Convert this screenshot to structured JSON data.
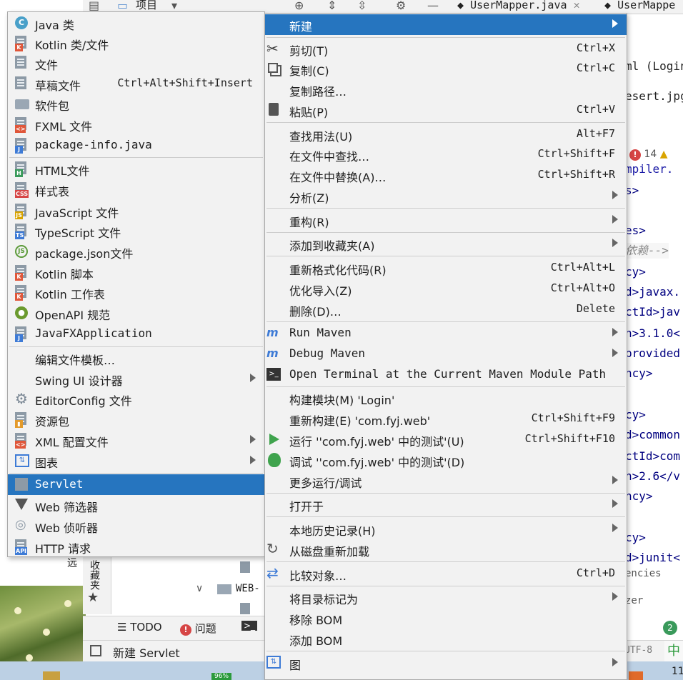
{
  "toolbar": {
    "project_label": "项目",
    "tabs": [
      {
        "label": "UserMapper.java"
      },
      {
        "label": "UserMappe"
      }
    ]
  },
  "editor": {
    "tab_fragments": [
      "ss",
      "ml (Login",
      "esert.jpg"
    ],
    "error_count": "14",
    "lines": [
      "mpiler.",
      "s>",
      "es>",
      "依赖-->",
      "cy>",
      "d>javax.",
      "ctId>jav",
      "n>3.1.0<",
      "provided",
      "ncy>",
      "cy>",
      "d>common",
      "ctId>com",
      "n>2.6</v",
      "ncy>",
      "cy>",
      "d>junit<",
      "encies",
      "zer"
    ]
  },
  "left_panel": {
    "favorites_label": "收藏夹",
    "tree_items": [
      "WEB-",
      "远"
    ]
  },
  "bottom_toolbar": {
    "todo": "TODO",
    "problems": "问题"
  },
  "status_bar": {
    "message": "新建 Servlet",
    "encoding": "UTF-8",
    "ime": "中"
  },
  "taskbar": {
    "battery": "96%",
    "clock_fragment": "11"
  },
  "new_submenu": {
    "items": [
      {
        "label": "Java 类",
        "icon": "java-class-icon"
      },
      {
        "label": "Kotlin 类/文件",
        "icon": "kotlin-icon"
      },
      {
        "label": "文件",
        "icon": "file-icon"
      },
      {
        "label": "草稿文件",
        "shortcut": "Ctrl+Alt+Shift+Insert",
        "icon": "scratch-file-icon"
      },
      {
        "label": "软件包",
        "icon": "package-icon"
      },
      {
        "label": "FXML 文件",
        "icon": "fxml-icon"
      },
      {
        "label": "package-info.java",
        "icon": "java-file-icon"
      },
      {
        "label": "HTML文件",
        "icon": "html-icon"
      },
      {
        "label": "样式表",
        "icon": "css-icon"
      },
      {
        "label": "JavaScript 文件",
        "icon": "js-icon"
      },
      {
        "label": "TypeScript 文件",
        "icon": "ts-icon"
      },
      {
        "label": "package.json文件",
        "icon": "nodejs-icon"
      },
      {
        "label": "Kotlin 脚本",
        "icon": "kotlin-icon"
      },
      {
        "label": "Kotlin 工作表",
        "icon": "kotlin-icon"
      },
      {
        "label": "OpenAPI 规范",
        "icon": "openapi-icon"
      },
      {
        "label": "JavaFXApplication",
        "icon": "java-file-icon"
      },
      {
        "label": "编辑文件模板…"
      },
      {
        "label": "Swing UI 设计器",
        "submenu": true
      },
      {
        "label": "EditorConfig 文件",
        "icon": "gear-icon"
      },
      {
        "label": "资源包",
        "icon": "resource-bundle-icon"
      },
      {
        "label": "XML 配置文件",
        "submenu": true,
        "icon": "xml-icon"
      },
      {
        "label": "图表",
        "submenu": true,
        "icon": "diagram-icon"
      },
      {
        "label": "Servlet",
        "selected": true,
        "icon": "servlet-icon"
      },
      {
        "label": "Web 筛选器",
        "icon": "filter-icon"
      },
      {
        "label": "Web 侦听器",
        "icon": "listener-icon"
      },
      {
        "label": "HTTP 请求",
        "icon": "api-icon"
      }
    ]
  },
  "context_menu": {
    "items": [
      {
        "label": "新建",
        "submenu": true,
        "selected": true
      },
      {
        "label": "剪切(T)",
        "shortcut": "Ctrl+X",
        "icon": "scissors-icon"
      },
      {
        "label": "复制(C)",
        "shortcut": "Ctrl+C",
        "icon": "copy-icon"
      },
      {
        "label": "复制路径…"
      },
      {
        "label": "粘贴(P)",
        "shortcut": "Ctrl+V",
        "icon": "paste-icon"
      },
      {
        "label": "查找用法(U)",
        "shortcut": "Alt+F7"
      },
      {
        "label": "在文件中查找…",
        "shortcut": "Ctrl+Shift+F"
      },
      {
        "label": "在文件中替换(A)…",
        "shortcut": "Ctrl+Shift+R"
      },
      {
        "label": "分析(Z)",
        "submenu": true
      },
      {
        "label": "重构(R)",
        "submenu": true
      },
      {
        "label": "添加到收藏夹(A)",
        "submenu": true
      },
      {
        "label": "重新格式化代码(R)",
        "shortcut": "Ctrl+Alt+L"
      },
      {
        "label": "优化导入(Z)",
        "shortcut": "Ctrl+Alt+O"
      },
      {
        "label": "删除(D)…",
        "shortcut": "Delete"
      },
      {
        "label": "Run Maven",
        "submenu": true,
        "icon": "maven-run-icon"
      },
      {
        "label": "Debug Maven",
        "submenu": true,
        "icon": "maven-debug-icon"
      },
      {
        "label": "Open Terminal at the Current Maven Module Path",
        "icon": "terminal-icon"
      },
      {
        "label": "构建模块(M) 'Login'"
      },
      {
        "label": "重新构建(E) 'com.fyj.web'",
        "shortcut": "Ctrl+Shift+F9"
      },
      {
        "label": "运行 ''com.fyj.web' 中的测试'(U)",
        "shortcut": "Ctrl+Shift+F10",
        "icon": "run-icon"
      },
      {
        "label": "调试 ''com.fyj.web' 中的测试'(D)",
        "icon": "debug-icon"
      },
      {
        "label": "更多运行/调试",
        "submenu": true
      },
      {
        "label": "打开于",
        "submenu": true
      },
      {
        "label": "本地历史记录(H)",
        "submenu": true
      },
      {
        "label": "从磁盘重新加载",
        "icon": "reload-icon"
      },
      {
        "label": "比较对象…",
        "shortcut": "Ctrl+D",
        "icon": "compare-icon"
      },
      {
        "label": "将目录标记为",
        "submenu": true
      },
      {
        "label": "移除 BOM"
      },
      {
        "label": "添加 BOM"
      },
      {
        "label": "图",
        "submenu": true,
        "icon": "diagram-icon"
      }
    ]
  },
  "colors": {
    "menu_bg": "#f2f2f2",
    "selection": "#2675bf",
    "separator": "#cdcdcd"
  }
}
